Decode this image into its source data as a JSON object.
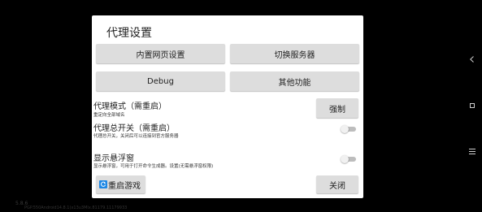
{
  "background_text": {
    "version": "5.8.6",
    "build_info": "PGP.550Android14.8.1(x13u3Mlx.81179.11179933"
  },
  "dialog": {
    "title": "代理设置",
    "buttons": {
      "inner_web": "内置网页设置",
      "switch_server": "切换服务器",
      "debug": "Debug",
      "other": "其他功能",
      "force": "强制",
      "restart": "重启游戏",
      "close": "关闭"
    },
    "settings": [
      {
        "label": "代理模式（需重启）",
        "desc": "重定向全部域名"
      },
      {
        "label": "代理总开关（需重启）",
        "desc": "代理总开关，关闭后可以连接到官方服务器",
        "enabled": false
      },
      {
        "label": "显示悬浮窗",
        "desc": "显示悬浮窗，可用于打开命令生成器。设置(无需悬浮窗权限)",
        "enabled": false
      }
    ]
  },
  "colors": {
    "button_bg": "#dddddd",
    "dialog_bg": "#ffffff",
    "switch_off_track": "#bdbdbd",
    "restart_icon": "#1e88e5"
  },
  "icons": {
    "restart": "restart-icon",
    "nav_back": "back-triangle-icon",
    "nav_home": "home-square-icon",
    "nav_menu": "menu-lines-icon"
  }
}
